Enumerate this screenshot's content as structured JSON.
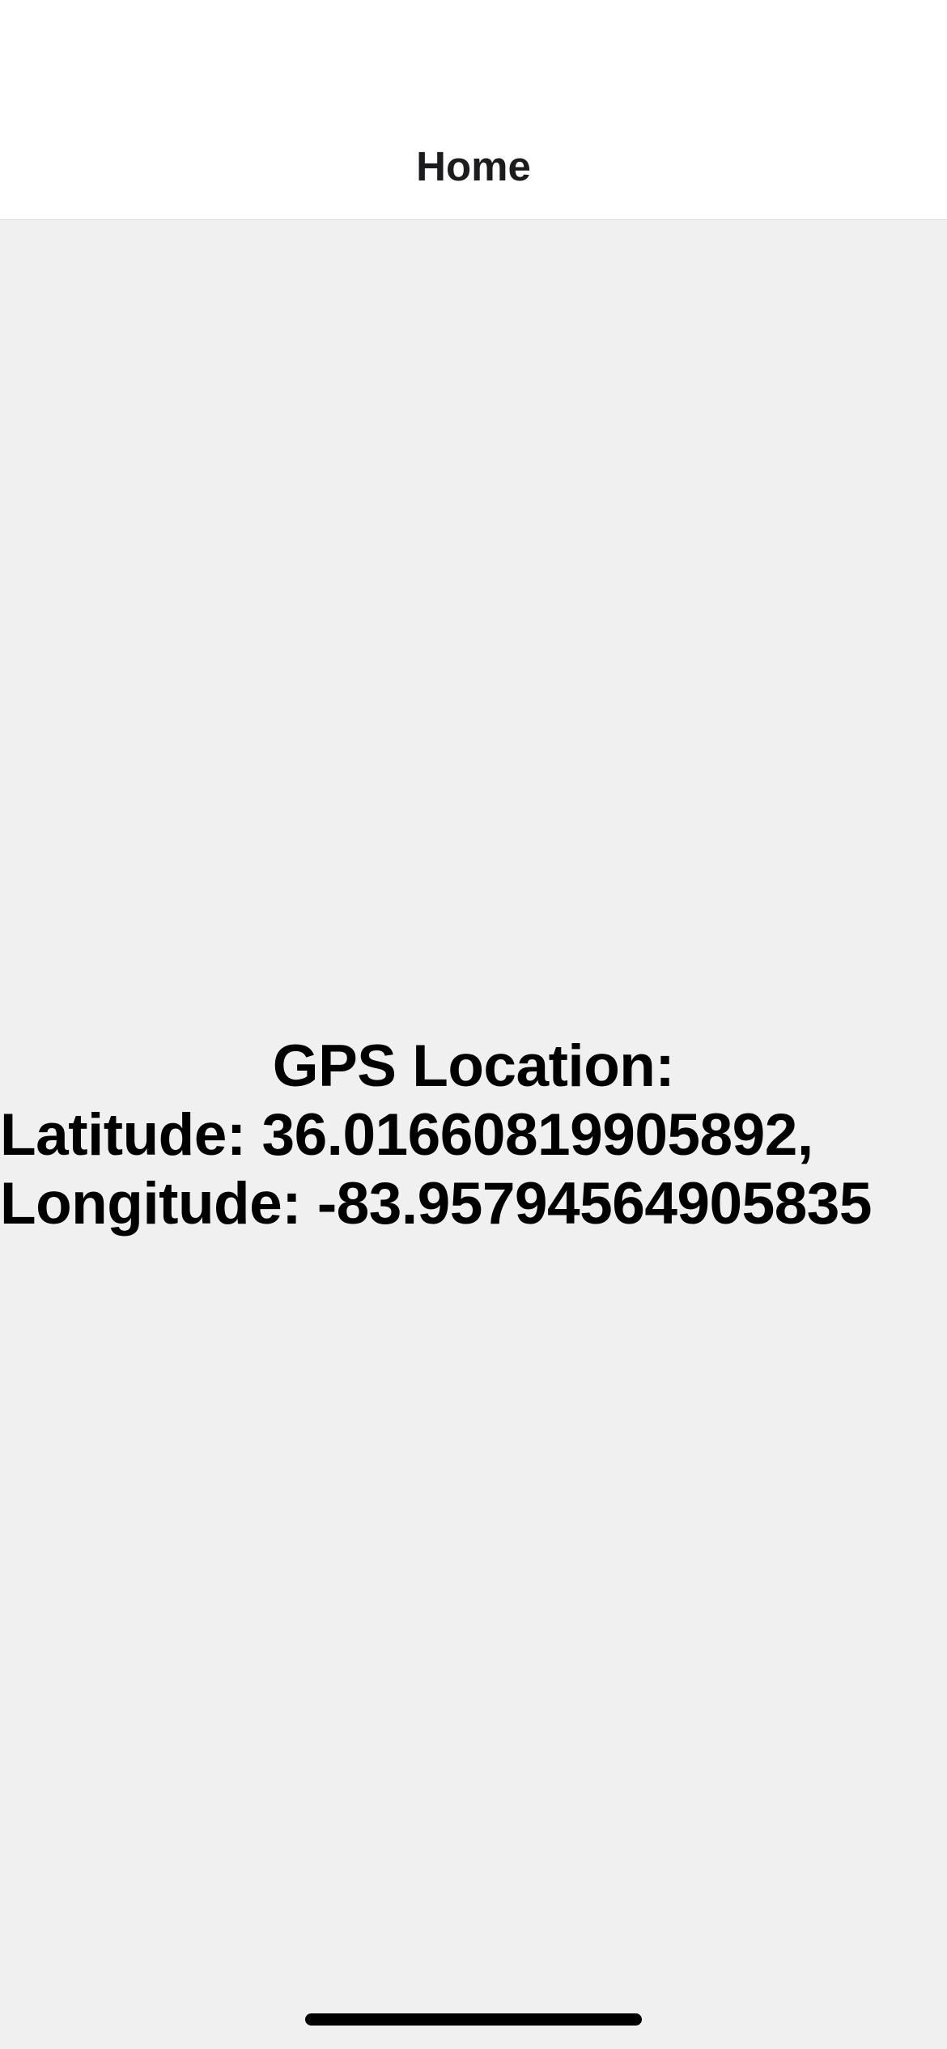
{
  "nav": {
    "title": "Home"
  },
  "gps": {
    "heading": "GPS Location:",
    "latitude_line": "Latitude: 36.01660819905892,",
    "longitude_line": "Longitude: -83.95794564905835"
  },
  "colors": {
    "nav_background": "#ffffff",
    "content_background": "#f0f0f0",
    "text": "#000000",
    "nav_title": "#1c1c1e"
  }
}
